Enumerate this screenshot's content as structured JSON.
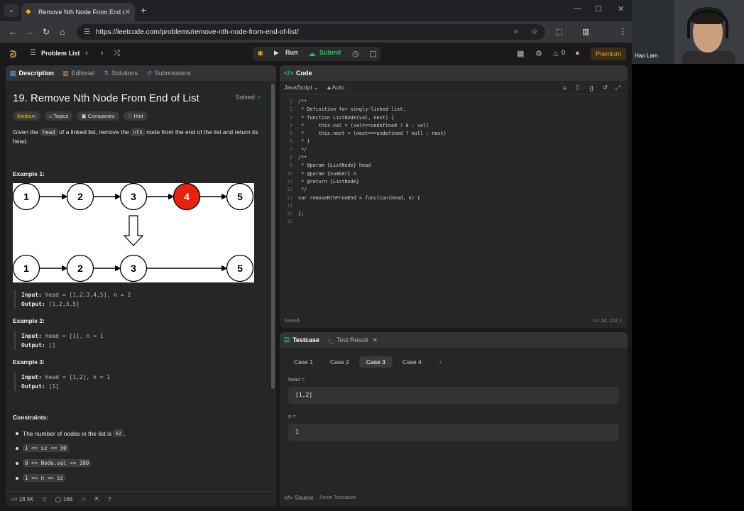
{
  "browser": {
    "tab_title": "Remove Nth Node From End o",
    "tab_close": "✕",
    "new_tab": "+",
    "url": "https://leetcode.com/problems/remove-nth-node-from-end-of-list/"
  },
  "header": {
    "problem_list": "Problem List",
    "run": "Run",
    "submit": "Submit",
    "streak": "0",
    "premium": "Premium"
  },
  "left_tabs": [
    "Description",
    "Editorial",
    "Solutions",
    "Submissions"
  ],
  "problem": {
    "title": "19. Remove Nth Node From End of List",
    "solved": "Solved",
    "tags": [
      "Medium",
      "Topics",
      "Companies",
      "Hint"
    ],
    "desc_1": "Given the ",
    "desc_head": "head",
    "desc_2": " of a linked list, remove the ",
    "desc_nth": "nth",
    "desc_3": " node from the end of the list and return its head.",
    "example1_title": "Example 1:",
    "diagram": {
      "top": [
        "1",
        "2",
        "3",
        "4",
        "5"
      ],
      "bottom": [
        "1",
        "2",
        "3",
        "5"
      ]
    },
    "ex1_input_label": "Input:",
    "ex1_input": "head = [1,2,3,4,5], n = 2",
    "ex1_output_label": "Output:",
    "ex1_output": "[1,2,3,5]",
    "example2_title": "Example 2:",
    "ex2_input_label": "Input:",
    "ex2_input": "head = [1], n = 1",
    "ex2_output_label": "Output:",
    "ex2_output": "[]",
    "example3_title": "Example 3:",
    "ex3_input_label": "Input:",
    "ex3_input": "head = [1,2], n = 1",
    "ex3_output_label": "Output:",
    "ex3_output": "[1]",
    "constraints_title": "Constraints:",
    "c1_text": "The number of nodes in the list is ",
    "c1_code": "sz",
    "c1_end": ".",
    "c2": "1 <= sz <= 30",
    "c3": "0 <= Node.val <= 100",
    "c4": "1 <= n <= sz"
  },
  "footer": {
    "likes": "18.5K",
    "comments": "168"
  },
  "code_panel": {
    "title": "Code",
    "language": "JavaScript",
    "auto": "Auto",
    "saved": "Saved",
    "cursor": "Ln 14, Col 1",
    "lines": [
      {
        "n": "1",
        "t": "/**"
      },
      {
        "n": "2",
        "t": " * Definition for singly-linked list."
      },
      {
        "n": "3",
        "t": " * function ListNode(val, next) {"
      },
      {
        "n": "4",
        "t": " *     this.val = (val===undefined ? 0 : val)"
      },
      {
        "n": "5",
        "t": " *     this.next = (next===undefined ? null : next)"
      },
      {
        "n": "6",
        "t": " * }"
      },
      {
        "n": "7",
        "t": " */"
      },
      {
        "n": "8",
        "t": "/**"
      },
      {
        "n": "9",
        "t": " * @param {ListNode} head"
      },
      {
        "n": "10",
        "t": " * @param {number} n"
      },
      {
        "n": "11",
        "t": " * @return {ListNode}"
      },
      {
        "n": "12",
        "t": " */"
      },
      {
        "n": "13",
        "t": "var removeNthFromEnd = function(head, n) {"
      },
      {
        "n": "14",
        "t": ""
      },
      {
        "n": "15",
        "t": "};"
      },
      {
        "n": "16",
        "t": ""
      }
    ]
  },
  "testcase_panel": {
    "tab_testcase": "Testcase",
    "tab_result": "Test Result",
    "cases": [
      "Case 1",
      "Case 2",
      "Case 3",
      "Case 4"
    ],
    "add": "+",
    "selected_case": "Case 3",
    "head_label": "head =",
    "head_value": "[1,2]",
    "n_label": "n =",
    "n_value": "1",
    "source": "Source",
    "reset": "Reset Testcases"
  },
  "webcam": {
    "name": "Hao Lam"
  },
  "colors": {
    "accent_orange": "#ffa116",
    "green": "#2cbb5d",
    "medium": "#ffb800",
    "highlight_node": "#e8220f"
  }
}
